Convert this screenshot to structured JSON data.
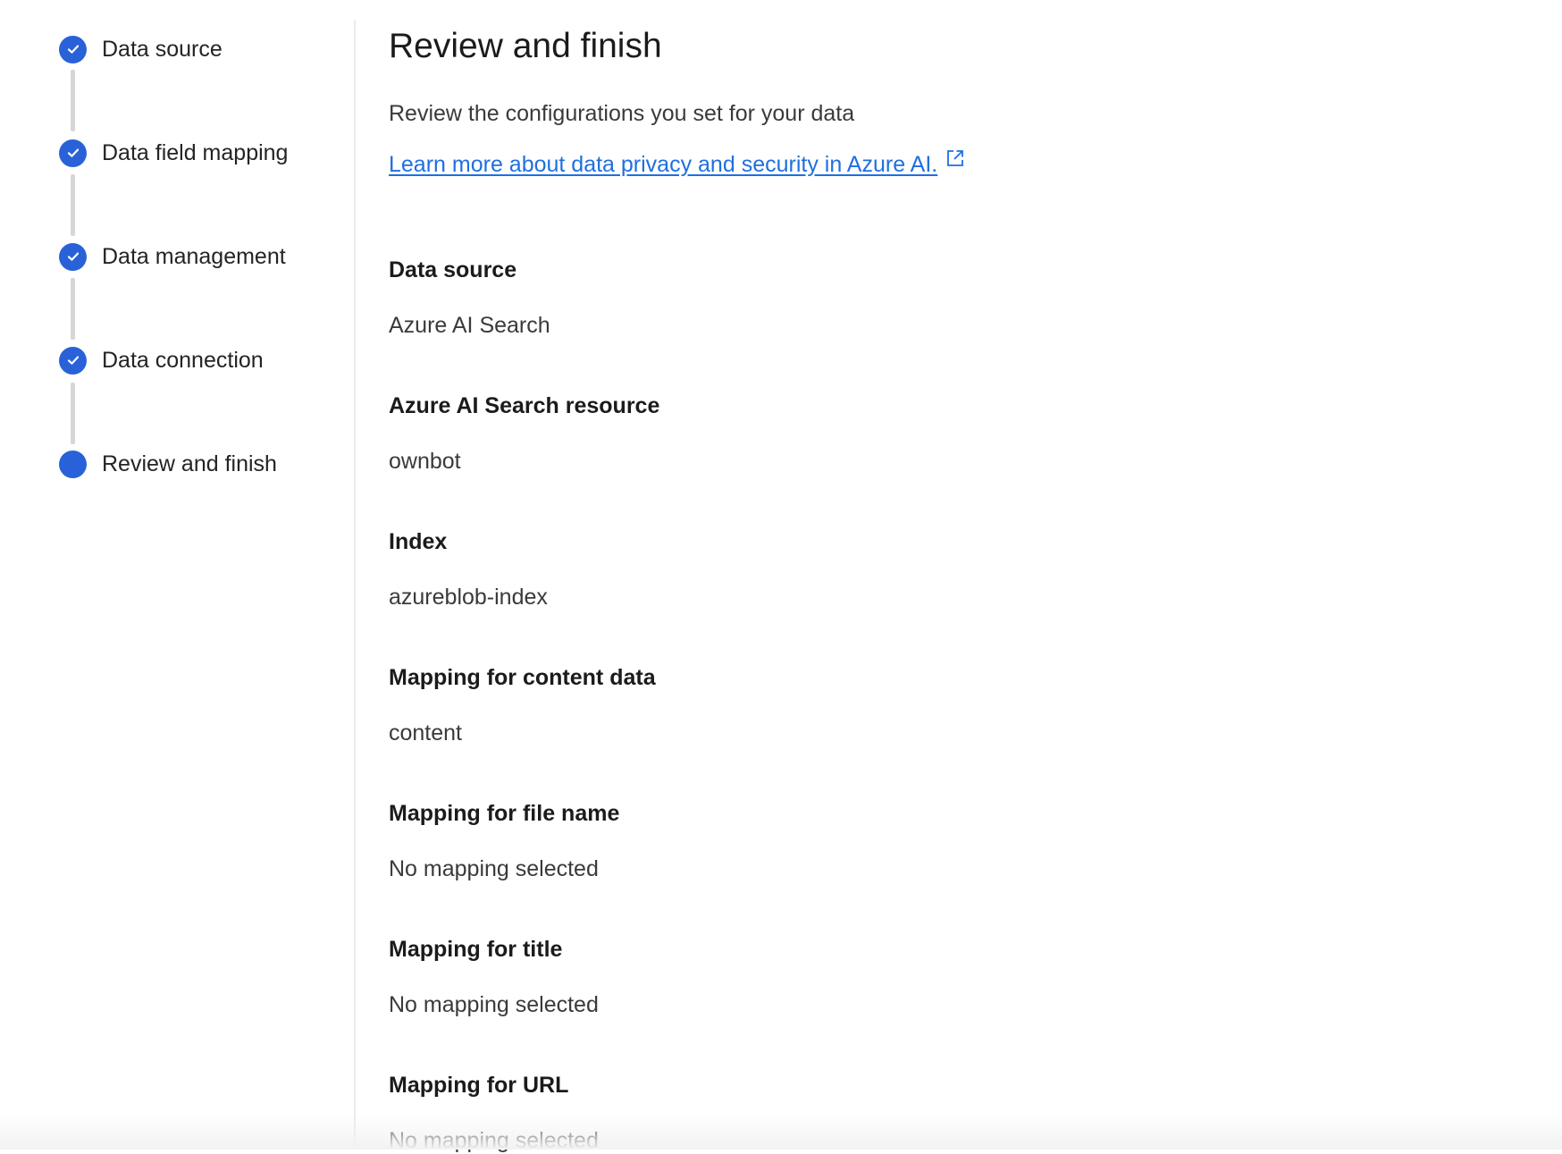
{
  "stepper": {
    "steps": [
      {
        "label": "Data source",
        "state": "completed"
      },
      {
        "label": "Data field mapping",
        "state": "completed"
      },
      {
        "label": "Data management",
        "state": "completed"
      },
      {
        "label": "Data connection",
        "state": "completed"
      },
      {
        "label": "Review and finish",
        "state": "current"
      }
    ]
  },
  "main": {
    "title": "Review and finish",
    "description": "Review the configurations you set for your data",
    "learn_more_link": "Learn more about data privacy and security in Azure AI.",
    "fields": [
      {
        "label": "Data source",
        "value": "Azure AI Search"
      },
      {
        "label": "Azure AI Search resource",
        "value": "ownbot"
      },
      {
        "label": "Index",
        "value": "azureblob-index"
      },
      {
        "label": "Mapping for content data",
        "value": "content"
      },
      {
        "label": "Mapping for file name",
        "value": "No mapping selected"
      },
      {
        "label": "Mapping for title",
        "value": "No mapping selected"
      },
      {
        "label": "Mapping for URL",
        "value": "No mapping selected"
      }
    ]
  },
  "colors": {
    "accent": "#2962d8",
    "link": "#1f6fe0",
    "connector": "#d6d6d6"
  },
  "icons": {
    "completed_step": "checkmark-icon",
    "external_link": "open-external-icon"
  }
}
